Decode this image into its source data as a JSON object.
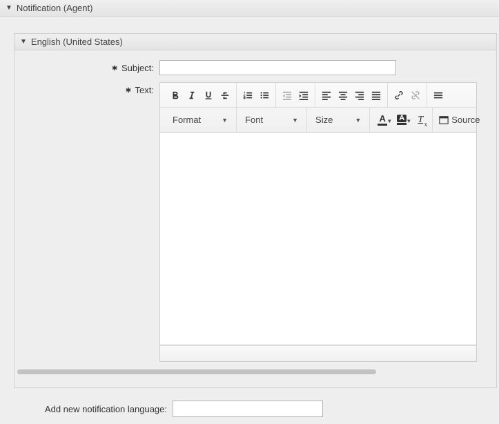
{
  "header": {
    "title": "Notification (Agent)"
  },
  "language_panel": {
    "title": "English (United States)"
  },
  "form": {
    "subject_label": "Subject:",
    "subject_value": "",
    "text_label": "Text:"
  },
  "toolbar": {
    "row1_icons": [
      "bold-icon",
      "italic-icon",
      "underline-icon",
      "strike-icon",
      "numbered-list-icon",
      "bullet-list-icon",
      "outdent-icon",
      "indent-icon",
      "align-left-icon",
      "align-center-icon",
      "align-right-icon",
      "justify-icon",
      "link-icon",
      "unlink-icon",
      "hr-icon"
    ],
    "format_label": "Format",
    "font_label": "Font",
    "size_label": "Size",
    "textcolor_glyph": "A",
    "bgcolor_glyph": "A",
    "erase_glyph": "T",
    "erase_sub": "x",
    "source_label": "Source"
  },
  "add_language": {
    "label": "Add new notification language:",
    "value": ""
  }
}
